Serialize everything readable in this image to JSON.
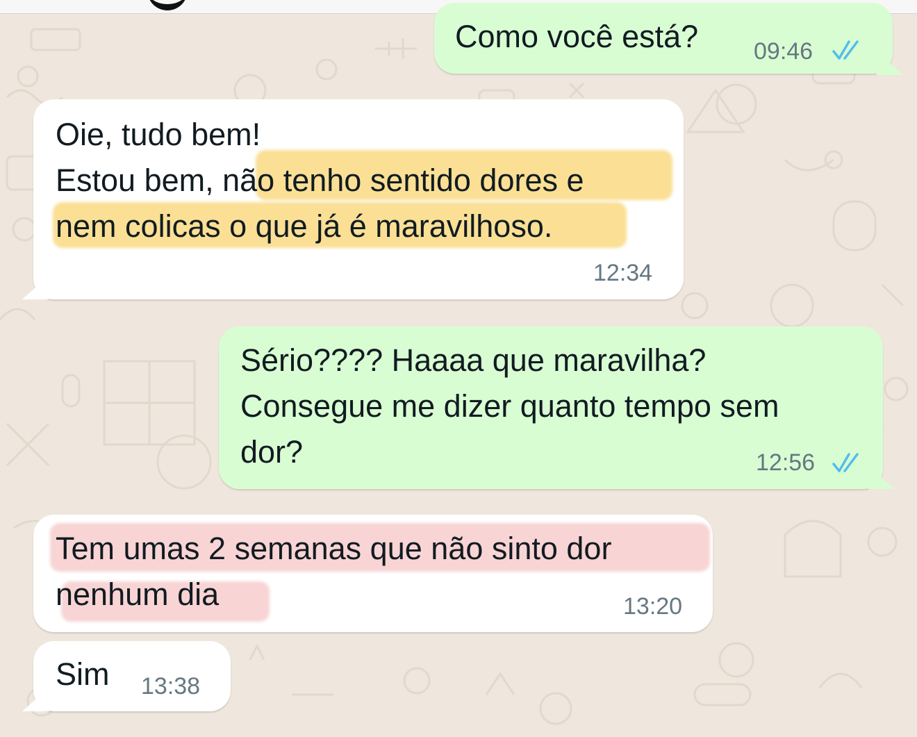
{
  "chat": {
    "messages": [
      {
        "direction": "outgoing",
        "lines": [
          "Como você está?"
        ],
        "time": "09:46",
        "status_icon": "double-check-read-icon"
      },
      {
        "direction": "incoming",
        "lines": [
          "Oie, tudo bem!",
          "Estou bem, não tenho sentido dores e",
          "nem colicas o que já é maravilhoso."
        ],
        "time": "12:34",
        "highlight_color": "#f7cc54"
      },
      {
        "direction": "outgoing",
        "lines": [
          "Sério???? Haaaa que maravilha?",
          "Consegue me dizer quanto tempo sem",
          "dor?"
        ],
        "time": "12:56",
        "status_icon": "double-check-read-icon"
      },
      {
        "direction": "incoming",
        "lines": [
          "Tem umas 2 semanas que não sinto dor",
          "nenhum dia"
        ],
        "time": "13:20",
        "highlight_color": "#f0a0a2"
      },
      {
        "direction": "incoming",
        "lines": [
          "Sim"
        ],
        "time": "13:38"
      }
    ]
  },
  "colors": {
    "outgoing_bubble": "#d9fdd3",
    "incoming_bubble": "#ffffff",
    "wallpaper": "#efe7dd",
    "read_receipt": "#53bdeb",
    "timestamp": "#667781"
  }
}
